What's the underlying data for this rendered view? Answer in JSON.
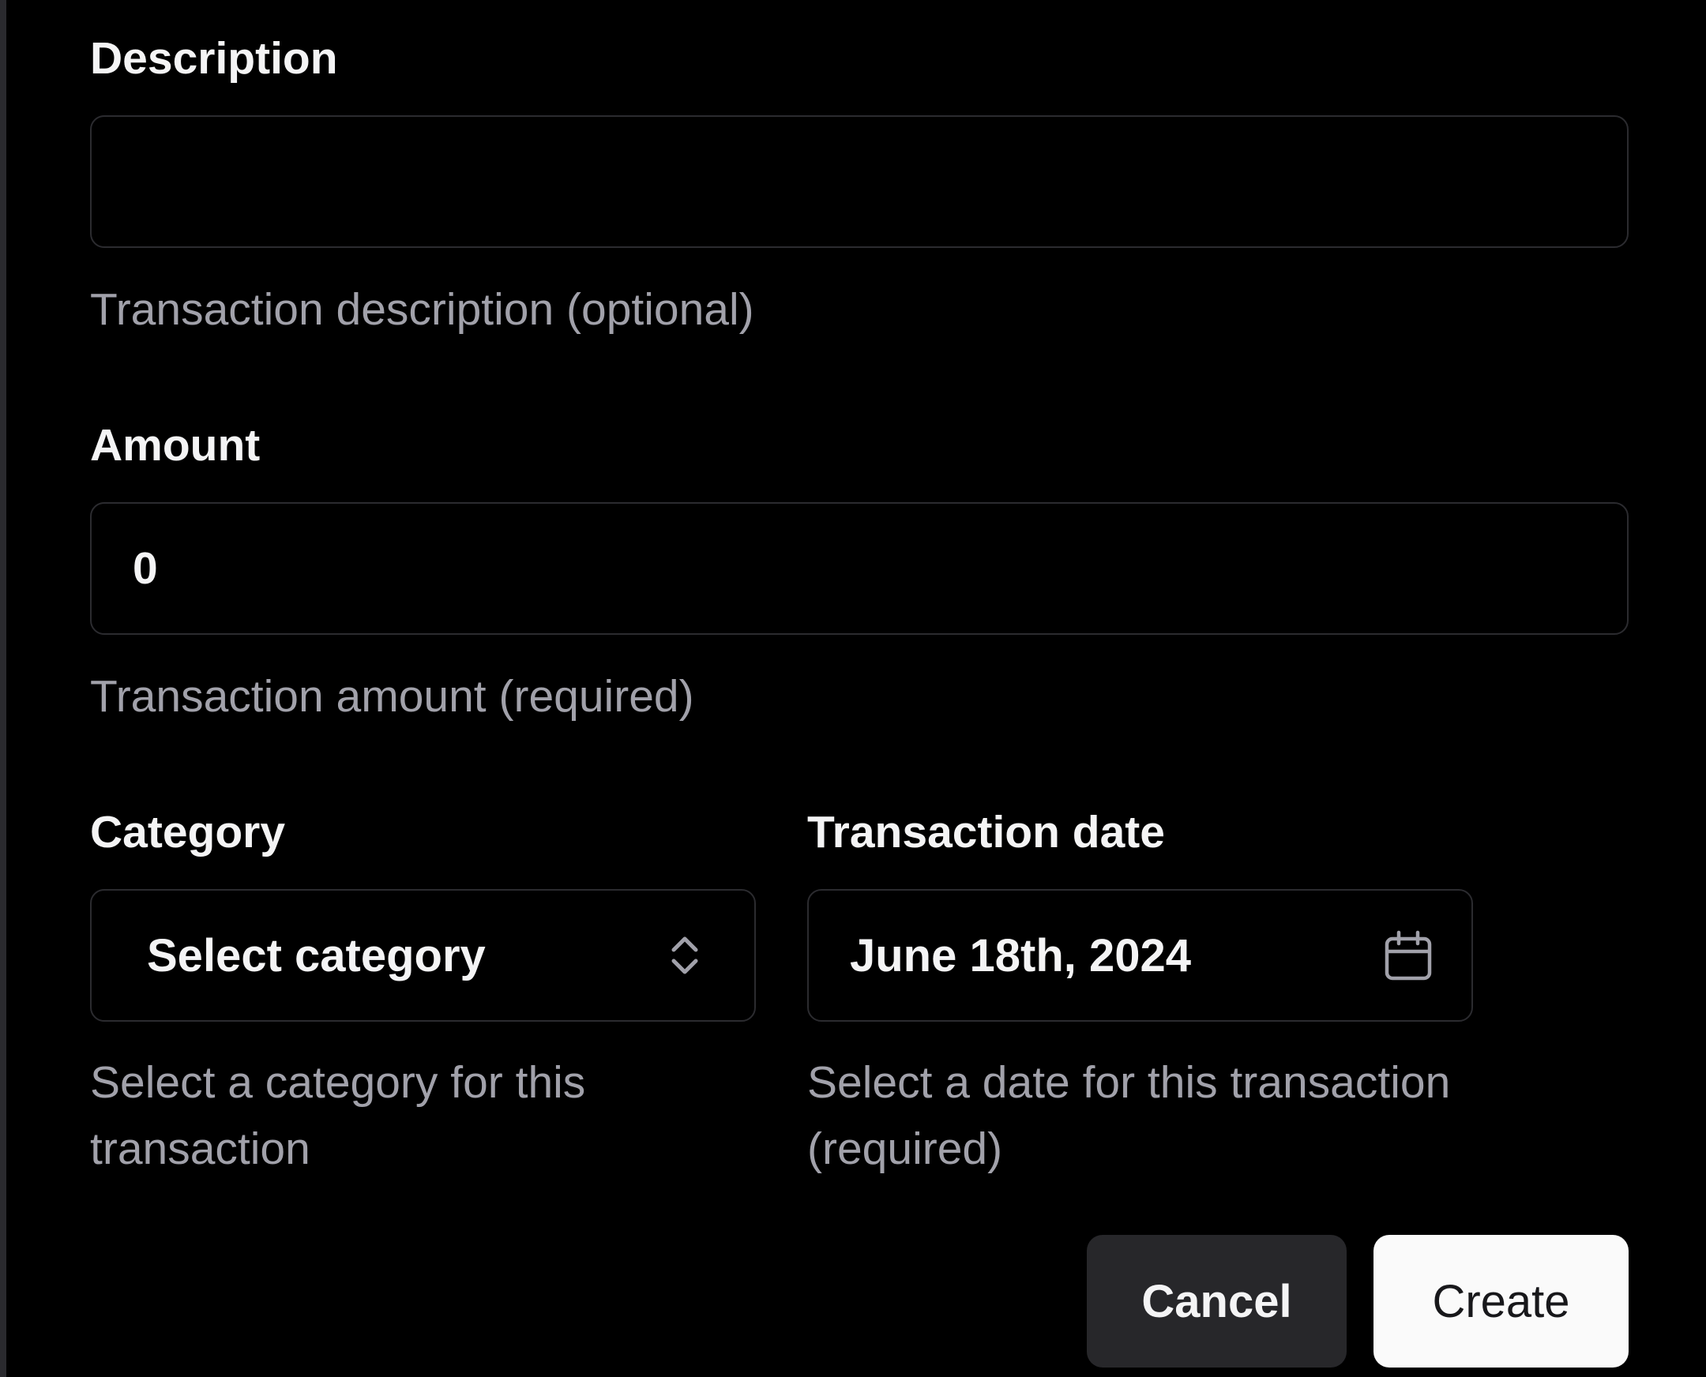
{
  "form": {
    "description": {
      "label": "Description",
      "value": "",
      "help": "Transaction description (optional)"
    },
    "amount": {
      "label": "Amount",
      "value": "0",
      "help": "Transaction amount (required)"
    },
    "category": {
      "label": "Category",
      "selected": "Select category",
      "help": "Select a category for this transaction",
      "icon": "chevrons-up-down-icon"
    },
    "date": {
      "label": "Transaction date",
      "value": "June 18th, 2024",
      "help": "Select a date for this transaction (required)",
      "icon": "calendar-icon"
    }
  },
  "actions": {
    "cancel_label": "Cancel",
    "create_label": "Create"
  },
  "colors": {
    "background": "#000000",
    "text": "#f4f4f5",
    "muted": "#a1a1aa",
    "border": "#2b2b2f",
    "cancel_bg": "#27272a",
    "create_bg": "#fafafa"
  }
}
